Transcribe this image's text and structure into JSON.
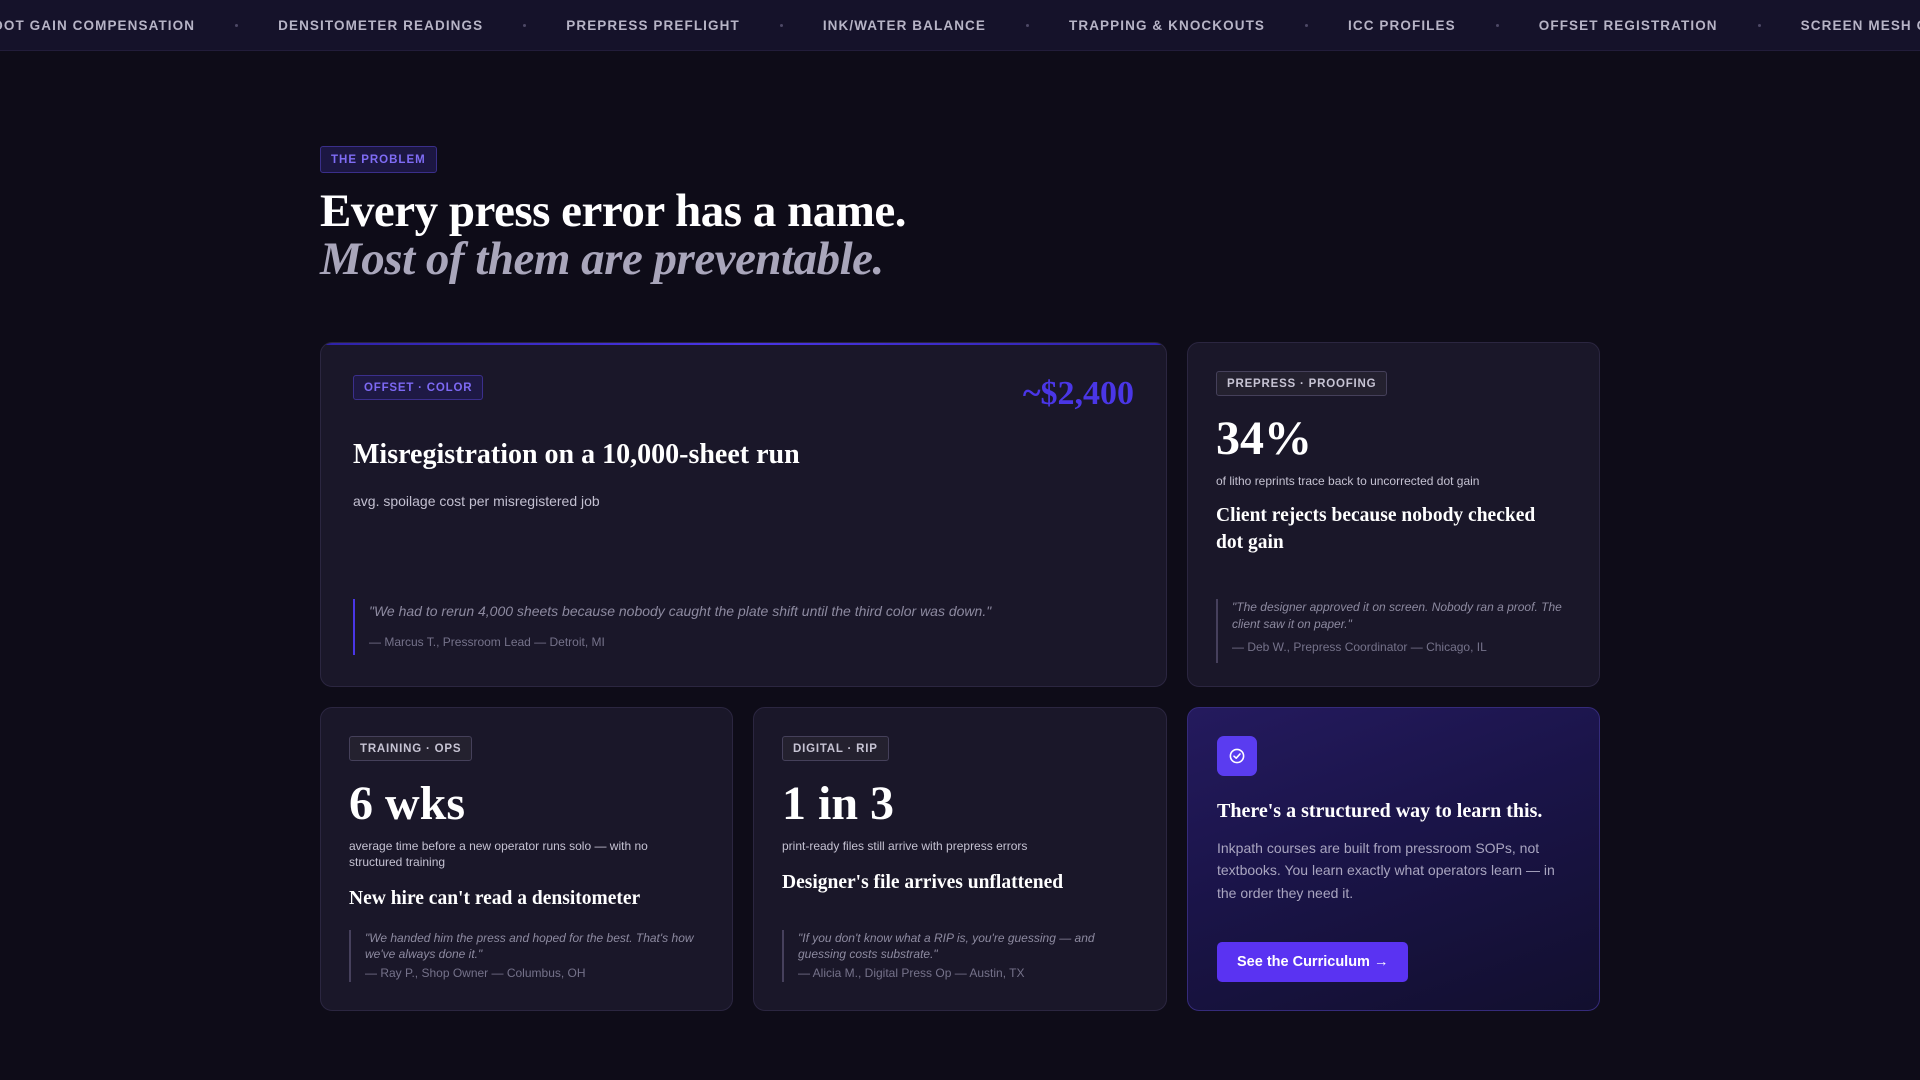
{
  "ticker": {
    "items": [
      "DOT GAIN COMPENSATION",
      "DENSITOMETER READINGS",
      "PREPRESS PREFLIGHT",
      "INK/WATER BALANCE",
      "TRAPPING & KNOCKOUTS",
      "ICC PROFILES",
      "OFFSET REGISTRATION",
      "SCREEN MESH COUNTS"
    ]
  },
  "header": {
    "tag": "THE PROBLEM",
    "headline": "Every press error has a name.",
    "subheadline": "Most of them are preventable."
  },
  "cards": {
    "misregistration": {
      "tag": "OFFSET · COLOR",
      "cost": "~$2,400",
      "title": "Misregistration on a 10,000-sheet run",
      "subtitle": "avg. spoilage cost per misregistered job",
      "quote": "\"We had to rerun 4,000 sheets because nobody caught the plate shift until the third color was down.\"",
      "author": "— Marcus T., Pressroom Lead — Detroit, MI"
    },
    "dot_gain": {
      "tag": "PREPRESS · PROOFING",
      "stat": "34%",
      "stat_note": "of litho reprints trace back to uncorrected dot gain",
      "title": "Client rejects because nobody checked dot gain",
      "quote": "\"The designer approved it on screen. Nobody ran a proof. The client saw it on paper.\"",
      "author": "— Deb W., Prepress Coordinator — Chicago, IL"
    },
    "training": {
      "tag": "TRAINING · OPS",
      "stat": "6 wks",
      "stat_note": "average time before a new operator runs solo — with no structured training",
      "title": "New hire can't read a densitometer",
      "quote": "\"We handed him the press and hoped for the best. That's how we've always done it.\"",
      "author": "— Ray P., Shop Owner — Columbus, OH"
    },
    "digital_rip": {
      "tag": "DIGITAL · RIP",
      "stat": "1 in 3",
      "stat_note": "print-ready files still arrive with prepress errors",
      "title": "Designer's file arrives unflattened",
      "quote": "\"If you don't know what a RIP is, you're guessing — and guessing costs substrate.\"",
      "author": "— Alicia M., Digital Press Op — Austin, TX"
    }
  },
  "cta": {
    "icon": "check-circle-icon",
    "title": "There's a structured way to learn this.",
    "body": "Inkpath courses are built from pressroom SOPs, not textbooks. You learn exactly what operators learn — in the order they need it.",
    "button": "See the Curriculum →"
  },
  "colors": {
    "background": "#0e0c18",
    "card": "#1a1729",
    "accent": "#4a36e6",
    "button": "#5a33f2"
  }
}
